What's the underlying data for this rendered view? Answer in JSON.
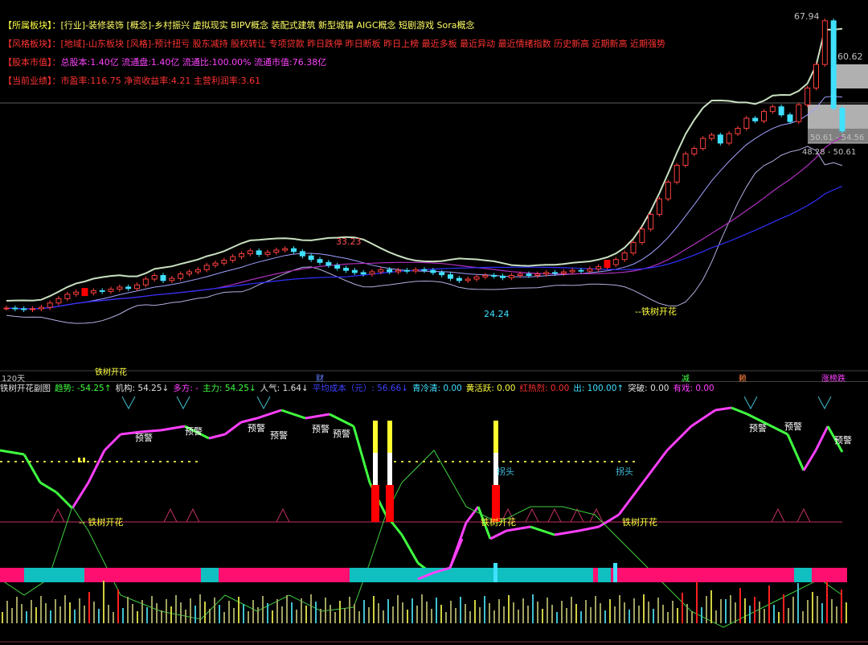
{
  "info_rows": [
    {
      "key": "【所属板块】：",
      "key_color": "#ffff44",
      "content": "[行业]-装修装饰 [概念]-乡村振兴 虚拟现实 BIPV概念 装配式建筑 新型城镇 AIGC概念 短剧游戏 Sora概念",
      "color": "#ffff66"
    },
    {
      "key": "【风格板块】：",
      "key_color": "#ff3333",
      "content": "[地域]-山东板块 [风格]-预计扭亏 股东减持 股权转让 专项贷款 昨日跌停 昨日断板 昨日上榜 最近多板 最近异动 最近情绪指数 历史新高 近期新高 近期强势",
      "color": "#ff3333"
    },
    {
      "key": "【股本市值】：",
      "key_color": "#ff3333",
      "content": "总股本:1.40亿 流通盘:1.40亿 流通比:100.00% 流通市值:76.38亿",
      "color": "#ff44ff"
    },
    {
      "key": "【当前业绩】：",
      "key_color": "#ff3333",
      "content": "市盈率:116.75 净资收益率:4.21 主营利润率:3.61",
      "color": "#ff3333"
    }
  ],
  "main_chart": {
    "price_labels": [
      {
        "text": "67.94",
        "color": "#c0c0c0"
      },
      {
        "text": "33.23",
        "color": "#ff5050"
      },
      {
        "text": "24.24",
        "color": "#40e0ff"
      },
      {
        "text": "60.62",
        "color": "#c0c0c0"
      },
      {
        "text": "50.61 - 54.56",
        "color": "#c0c0c0"
      },
      {
        "text": "48.28 - 50.61",
        "color": "#c0c0c0"
      }
    ],
    "signal_label": "铁树开花",
    "bottom_left_label": "120天",
    "strip_labels": [
      {
        "text": "财",
        "color": "#6080ff"
      },
      {
        "text": "减",
        "color": "#40ff40"
      },
      {
        "text": "赖",
        "color": "#ff8040"
      },
      {
        "text": "涨榜跌",
        "color": "#ff40ff"
      }
    ],
    "series_bands": {
      "colors": {
        "upper": "#c8e0c0",
        "mid": "#a0a0ff",
        "lower": "#b0b0e0",
        "ma_long": "#b030c0",
        "ma_short": "#3030ff"
      }
    }
  },
  "indicator_header": [
    {
      "text": "铁树开花副图",
      "color": "#e0e0e0"
    },
    {
      "text": "趋势: -54.25↑",
      "color": "#40ff40"
    },
    {
      "text": "机构: 54.25↓",
      "color": "#e0e0e0"
    },
    {
      "text": "多方: -",
      "color": "#ff40ff"
    },
    {
      "text": "主力: 54.25↓",
      "color": "#40ff40"
    },
    {
      "text": "人气: 1.64↓",
      "color": "#e0e0e0"
    },
    {
      "text": "平均成本（元）: 56.66↓",
      "color": "#4040ff"
    },
    {
      "text": "青冷清: 0.00",
      "color": "#40e0ff"
    },
    {
      "text": "黄活跃: 0.00",
      "color": "#ffff40"
    },
    {
      "text": "红热烈: 0.00",
      "color": "#ff3030"
    },
    {
      "text": "出: 100.00↑",
      "color": "#40e0ff"
    },
    {
      "text": "突破: 0.00",
      "color": "#e0e0e0"
    },
    {
      "text": "有戏: 0.00",
      "color": "#ff40ff"
    }
  ],
  "indicator": {
    "warning_label": "预警",
    "turn_label": "拐头",
    "signal_label": "铁树开花"
  },
  "chart_data": {
    "type": "candlestick",
    "ylim": [
      24.24,
      67.94
    ],
    "price_labels": {
      "high_1": 33.23,
      "low": 24.24,
      "high_2": 67.94,
      "level": 60.62
    },
    "price_ranges": [
      [
        50.61,
        54.56
      ],
      [
        48.28,
        50.61
      ]
    ],
    "closes": [
      24.9,
      24.8,
      24.7,
      24.8,
      25.0,
      25.6,
      26.2,
      26.8,
      27.1,
      27.0,
      27.3,
      27.2,
      27.5,
      27.8,
      27.6,
      28.1,
      28.9,
      29.4,
      28.7,
      29.0,
      29.6,
      29.9,
      30.2,
      30.8,
      31.1,
      31.5,
      32.0,
      32.4,
      32.8,
      32.3,
      32.6,
      32.9,
      33.1,
      32.7,
      32.1,
      31.6,
      31.2,
      30.8,
      30.4,
      30.1,
      29.8,
      29.6,
      29.9,
      30.2,
      29.9,
      30.1,
      30.0,
      30.2,
      30.1,
      29.8,
      29.5,
      29.0,
      28.7,
      28.9,
      29.2,
      29.4,
      29.3,
      29.1,
      29.4,
      29.6,
      29.4,
      29.6,
      29.8,
      29.7,
      29.9,
      30.1,
      30.0,
      30.3,
      30.6,
      30.9,
      31.6,
      32.5,
      34.0,
      36.0,
      38.2,
      40.5,
      43.0,
      45.5,
      47.2,
      48.0,
      49.5,
      50.0,
      48.8,
      50.2,
      51.0,
      52.5,
      52.1,
      53.5,
      54.2,
      53.0,
      52.0,
      54.5,
      57.0,
      60.5,
      67.0,
      54.0,
      50.6
    ]
  }
}
